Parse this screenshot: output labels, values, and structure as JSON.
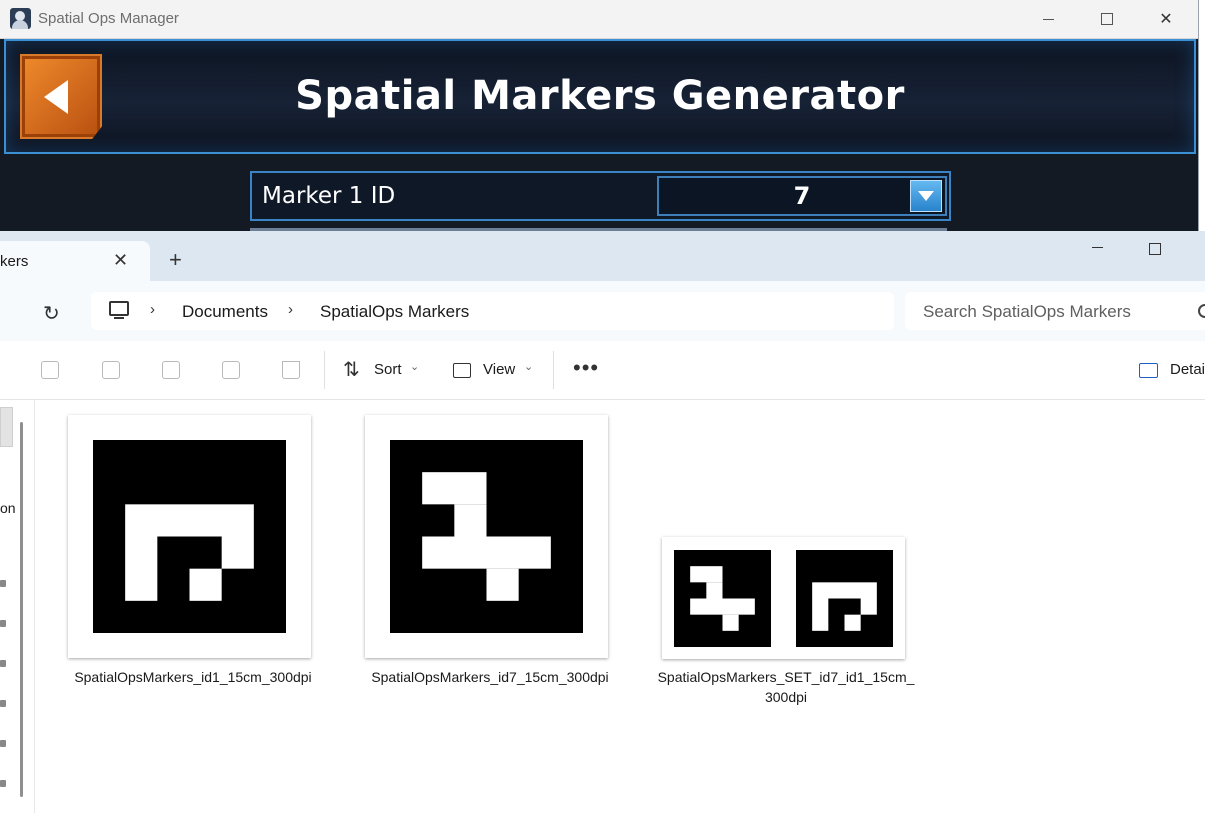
{
  "app": {
    "title": "Spatial Ops Manager",
    "heading": "Spatial Markers Generator",
    "marker_label": "Marker 1 ID",
    "marker_value": "7",
    "accent": "#3d8fd4",
    "back_color": "#e06e1c"
  },
  "explorer": {
    "tab_title": "kers",
    "breadcrumb": [
      "Documents",
      "SpatialOps Markers"
    ],
    "search_placeholder": "Search SpatialOps Markers",
    "toolbar": {
      "sort_label": "Sort",
      "view_label": "View",
      "more_label": "•••",
      "details_label": "Detai"
    },
    "nav_text": "on",
    "files": [
      {
        "name": "SpatialOpsMarkers_id1_15cm_300dpi",
        "thumbnail": "marker id1"
      },
      {
        "name": "SpatialOpsMarkers_id7_15cm_300dpi",
        "thumbnail": "marker id7"
      },
      {
        "name": "SpatialOpsMarkers_SET_id7_id1_15cm_300dpi",
        "name_line1": "SpatialOpsMarkers_SET_id7_id1_15cm_",
        "name_line2": "300dpi",
        "thumbnail": "marker set id7 + id1"
      }
    ]
  }
}
